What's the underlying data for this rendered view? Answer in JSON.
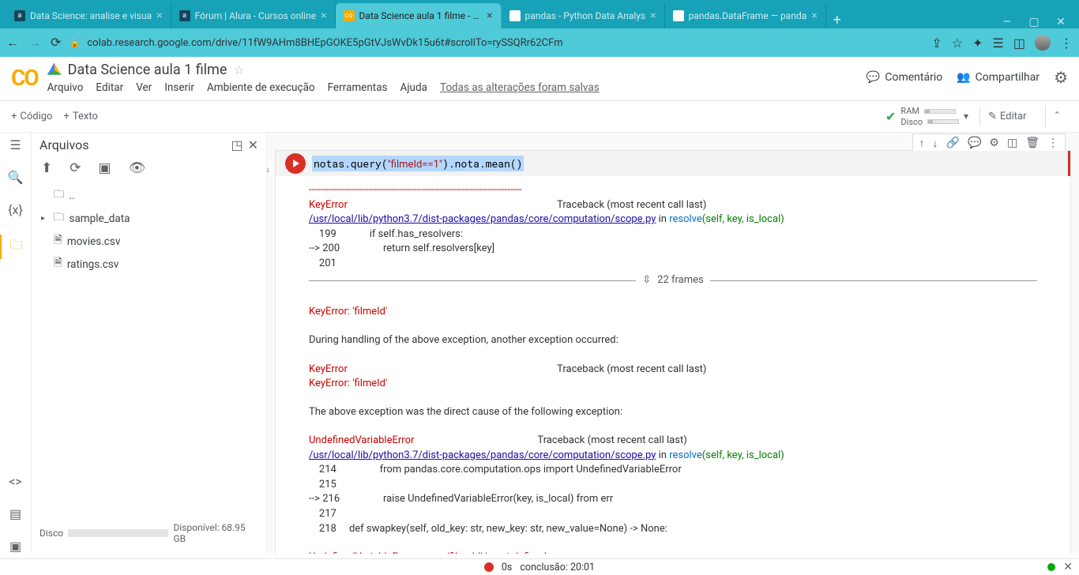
{
  "tabs": [
    {
      "label": "Data Science: analise e visua"
    },
    {
      "label": "Fórum | Alura - Cursos online"
    },
    {
      "label": "Data Science aula 1 filme - Co",
      "active": true
    },
    {
      "label": "pandas - Python Data Analys"
    },
    {
      "label": "pandas.DataFrame — panda"
    }
  ],
  "url": "colab.research.google.com/drive/11fW9AHm8BHEpGOKE5pGtVJsWvDk15u6t#scrollTo=rySSQRr62CFm",
  "doc": {
    "title": "Data Science aula 1 filme",
    "menu": [
      "Arquivo",
      "Editar",
      "Ver",
      "Inserir",
      "Ambiente de execução",
      "Ferramentas",
      "Ajuda"
    ],
    "saved": "Todas as alterações foram salvas",
    "comment": "Comentário",
    "share": "Compartilhar"
  },
  "toolbar": {
    "code": "Código",
    "text": "Texto",
    "ram": "RAM",
    "disk": "Disco",
    "edit": "Editar"
  },
  "files": {
    "title": "Arquivos",
    "parent": "..",
    "folder": "sample_data",
    "items": [
      "movies.csv",
      "ratings.csv"
    ],
    "disk_label": "Disco",
    "disk_free": "Disponível: 68.95 GB"
  },
  "cell": {
    "time": "0s",
    "code": "notas.query(\"filmeId==1\").nota.mean()",
    "dash": "---------------------------------------------------------------------------",
    "err1": "KeyError",
    "tb": "Traceback (most recent call last)",
    "path": "/usr/local/lib/python3.7/dist-packages/pandas/core/computation/scope.py",
    "in": " in ",
    "resolve": "resolve",
    "sig": "(self, key, is_local)",
    "l199": "    199             if self.has_resolvers:",
    "l200": "--> 200                 return self.resolvers[key]",
    "l201": "    201 ",
    "frames": "22 frames",
    "key_filme": "KeyError: 'filmeId'",
    "during": "During handling of the above exception, another exception occurred:",
    "above": "The above exception was the direct cause of the following exception:",
    "uve": "UndefinedVariableError",
    "l214": "    214                 from pandas.core.computation.ops import UndefinedVariableError",
    "l215": "    215 ",
    "l216": "--> 216                 raise UndefinedVariableError(key, is_local) from err",
    "l217": "    217 ",
    "l218": "    218     def swapkey(self, old_key: str, new_key: str, new_value=None) -> None:",
    "uve_msg": "UndefinedVariableError: name 'filmeId' is not defined"
  },
  "status": {
    "time": "0s",
    "concl": "conclusão: 20:01"
  }
}
